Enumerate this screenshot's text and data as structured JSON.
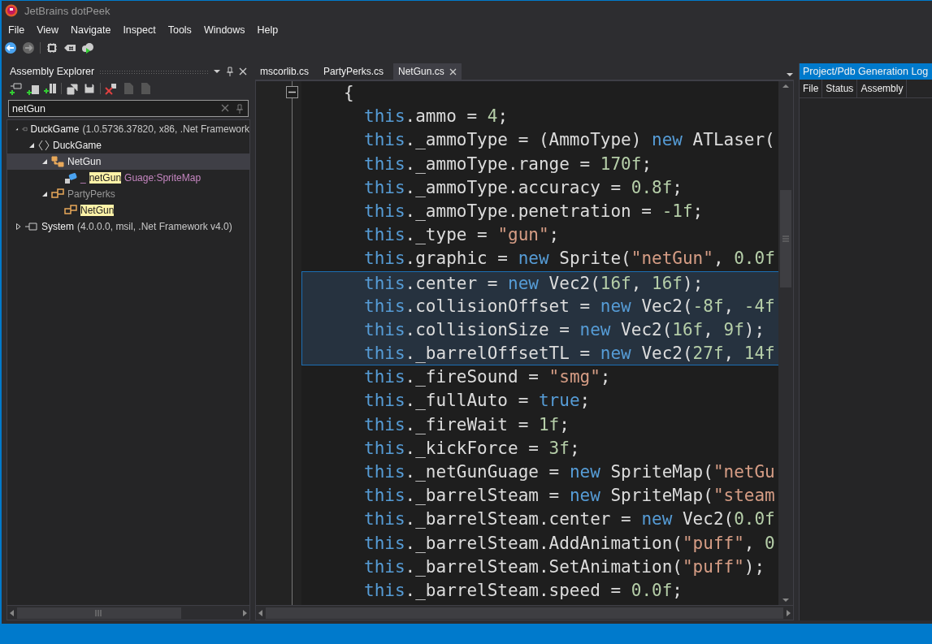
{
  "window": {
    "title": "JetBrains dotPeek"
  },
  "menu": [
    "File",
    "View",
    "Navigate",
    "Inspect",
    "Tools",
    "Windows",
    "Help"
  ],
  "assembly_explorer": {
    "title": "Assembly Explorer",
    "search": {
      "value": "netGun"
    },
    "tree": [
      {
        "kind": "assembly",
        "expanded": true,
        "selected": false,
        "parts": [
          {
            "text": "DuckGame",
            "kind": "name",
            "match": false
          },
          {
            "text": " (1.0.5736.37820, x86, .Net Framework",
            "kind": "meta",
            "match": false
          }
        ],
        "children": [
          {
            "kind": "namespace",
            "expanded": true,
            "selected": false,
            "parts": [
              {
                "text": "DuckGame",
                "kind": "name",
                "match": false
              }
            ],
            "children": [
              {
                "kind": "class",
                "expanded": true,
                "selected": true,
                "parts": [
                  {
                    "text": "NetGun",
                    "kind": "name",
                    "match": false
                  }
                ],
                "children": [
                  {
                    "kind": "field",
                    "selected": false,
                    "parts": [
                      {
                        "text": "_",
                        "kind": "member",
                        "match": false
                      },
                      {
                        "text": "netGun",
                        "kind": "name",
                        "match": true
                      },
                      {
                        "text": "Guage:SpriteMap",
                        "kind": "member",
                        "match": false
                      }
                    ]
                  }
                ]
              },
              {
                "kind": "type",
                "expanded": true,
                "selected": false,
                "parts": [
                  {
                    "text": "PartyPerks",
                    "kind": "dim",
                    "match": false
                  }
                ],
                "children": [
                  {
                    "kind": "type",
                    "selected": false,
                    "parts": [
                      {
                        "text": "NetGun",
                        "kind": "name",
                        "match": true
                      }
                    ]
                  }
                ]
              }
            ]
          }
        ]
      },
      {
        "kind": "assembly",
        "expanded": false,
        "selected": false,
        "parts": [
          {
            "text": "System",
            "kind": "name",
            "match": false
          },
          {
            "text": " (4.0.0.0, msil, .Net Framework v4.0)",
            "kind": "meta",
            "match": false
          }
        ]
      }
    ]
  },
  "tabs": [
    {
      "label": "mscorlib.cs",
      "selected": false
    },
    {
      "label": "PartyPerks.cs",
      "selected": false
    },
    {
      "label": "NetGun.cs",
      "selected": true
    }
  ],
  "code": [
    {
      "selected": false,
      "tokens": [
        {
          "text": "{",
          "kind": "plain"
        }
      ],
      "children": [
        {
          "selected": false,
          "tokens": [
            {
              "text": "this",
              "kind": "kw"
            },
            {
              "text": ".ammo = ",
              "kind": "plain"
            },
            {
              "text": "4",
              "kind": "num"
            },
            {
              "text": ";",
              "kind": "plain"
            }
          ]
        },
        {
          "selected": false,
          "tokens": [
            {
              "text": "this",
              "kind": "kw"
            },
            {
              "text": "._ammoType = (AmmoType) ",
              "kind": "plain"
            },
            {
              "text": "new",
              "kind": "kw"
            },
            {
              "text": " ATLaser(",
              "kind": "plain"
            }
          ]
        },
        {
          "selected": false,
          "tokens": [
            {
              "text": "this",
              "kind": "kw"
            },
            {
              "text": "._ammoType.range = ",
              "kind": "plain"
            },
            {
              "text": "170f",
              "kind": "num"
            },
            {
              "text": ";",
              "kind": "plain"
            }
          ]
        },
        {
          "selected": false,
          "tokens": [
            {
              "text": "this",
              "kind": "kw"
            },
            {
              "text": "._ammoType.accuracy = ",
              "kind": "plain"
            },
            {
              "text": "0.8f",
              "kind": "num"
            },
            {
              "text": ";",
              "kind": "plain"
            }
          ]
        },
        {
          "selected": false,
          "tokens": [
            {
              "text": "this",
              "kind": "kw"
            },
            {
              "text": "._ammoType.penetration = ",
              "kind": "plain"
            },
            {
              "text": "-1f",
              "kind": "num"
            },
            {
              "text": ";",
              "kind": "plain"
            }
          ]
        },
        {
          "selected": false,
          "tokens": [
            {
              "text": "this",
              "kind": "kw"
            },
            {
              "text": "._type = ",
              "kind": "plain"
            },
            {
              "text": "\"gun\"",
              "kind": "str"
            },
            {
              "text": ";",
              "kind": "plain"
            }
          ]
        },
        {
          "selected": false,
          "tokens": [
            {
              "text": "this",
              "kind": "kw"
            },
            {
              "text": ".graphic = ",
              "kind": "plain"
            },
            {
              "text": "new",
              "kind": "kw"
            },
            {
              "text": " Sprite(",
              "kind": "plain"
            },
            {
              "text": "\"netGun\"",
              "kind": "str"
            },
            {
              "text": ", ",
              "kind": "plain"
            },
            {
              "text": "0.0f",
              "kind": "num"
            }
          ]
        },
        {
          "selected": true,
          "tokens": [
            {
              "text": "this",
              "kind": "kw"
            },
            {
              "text": ".center = ",
              "kind": "plain"
            },
            {
              "text": "new",
              "kind": "kw"
            },
            {
              "text": " Vec2(",
              "kind": "plain"
            },
            {
              "text": "16f",
              "kind": "num"
            },
            {
              "text": ", ",
              "kind": "plain"
            },
            {
              "text": "16f",
              "kind": "num"
            },
            {
              "text": ");",
              "kind": "plain"
            }
          ]
        },
        {
          "selected": true,
          "tokens": [
            {
              "text": "this",
              "kind": "kw"
            },
            {
              "text": ".collisionOffset = ",
              "kind": "plain"
            },
            {
              "text": "new",
              "kind": "kw"
            },
            {
              "text": " Vec2(",
              "kind": "plain"
            },
            {
              "text": "-8f",
              "kind": "num"
            },
            {
              "text": ", ",
              "kind": "plain"
            },
            {
              "text": "-4f",
              "kind": "num"
            }
          ]
        },
        {
          "selected": true,
          "tokens": [
            {
              "text": "this",
              "kind": "kw"
            },
            {
              "text": ".collisionSize = ",
              "kind": "plain"
            },
            {
              "text": "new",
              "kind": "kw"
            },
            {
              "text": " Vec2(",
              "kind": "plain"
            },
            {
              "text": "16f",
              "kind": "num"
            },
            {
              "text": ", ",
              "kind": "plain"
            },
            {
              "text": "9f",
              "kind": "num"
            },
            {
              "text": ");",
              "kind": "plain"
            }
          ]
        },
        {
          "selected": true,
          "tokens": [
            {
              "text": "this",
              "kind": "kw"
            },
            {
              "text": "._barrelOffsetTL = ",
              "kind": "plain"
            },
            {
              "text": "new",
              "kind": "kw"
            },
            {
              "text": " Vec2(",
              "kind": "plain"
            },
            {
              "text": "27f",
              "kind": "num"
            },
            {
              "text": ", ",
              "kind": "plain"
            },
            {
              "text": "14f",
              "kind": "num"
            }
          ]
        },
        {
          "selected": false,
          "tokens": [
            {
              "text": "this",
              "kind": "kw"
            },
            {
              "text": "._fireSound = ",
              "kind": "plain"
            },
            {
              "text": "\"smg\"",
              "kind": "str"
            },
            {
              "text": ";",
              "kind": "plain"
            }
          ]
        },
        {
          "selected": false,
          "tokens": [
            {
              "text": "this",
              "kind": "kw"
            },
            {
              "text": "._fullAuto = ",
              "kind": "plain"
            },
            {
              "text": "true",
              "kind": "kw"
            },
            {
              "text": ";",
              "kind": "plain"
            }
          ]
        },
        {
          "selected": false,
          "tokens": [
            {
              "text": "this",
              "kind": "kw"
            },
            {
              "text": "._fireWait = ",
              "kind": "plain"
            },
            {
              "text": "1f",
              "kind": "num"
            },
            {
              "text": ";",
              "kind": "plain"
            }
          ]
        },
        {
          "selected": false,
          "tokens": [
            {
              "text": "this",
              "kind": "kw"
            },
            {
              "text": "._kickForce = ",
              "kind": "plain"
            },
            {
              "text": "3f",
              "kind": "num"
            },
            {
              "text": ";",
              "kind": "plain"
            }
          ]
        },
        {
          "selected": false,
          "tokens": [
            {
              "text": "this",
              "kind": "kw"
            },
            {
              "text": "._netGunGuage = ",
              "kind": "plain"
            },
            {
              "text": "new",
              "kind": "kw"
            },
            {
              "text": " SpriteMap(",
              "kind": "plain"
            },
            {
              "text": "\"netGu",
              "kind": "str"
            }
          ]
        },
        {
          "selected": false,
          "tokens": [
            {
              "text": "this",
              "kind": "kw"
            },
            {
              "text": "._barrelSteam = ",
              "kind": "plain"
            },
            {
              "text": "new",
              "kind": "kw"
            },
            {
              "text": " SpriteMap(",
              "kind": "plain"
            },
            {
              "text": "\"steam",
              "kind": "str"
            }
          ]
        },
        {
          "selected": false,
          "tokens": [
            {
              "text": "this",
              "kind": "kw"
            },
            {
              "text": "._barrelSteam.center = ",
              "kind": "plain"
            },
            {
              "text": "new",
              "kind": "kw"
            },
            {
              "text": " Vec2(",
              "kind": "plain"
            },
            {
              "text": "0.0f",
              "kind": "num"
            }
          ]
        },
        {
          "selected": false,
          "tokens": [
            {
              "text": "this",
              "kind": "kw"
            },
            {
              "text": "._barrelSteam.AddAnimation(",
              "kind": "plain"
            },
            {
              "text": "\"puff\"",
              "kind": "str"
            },
            {
              "text": ", ",
              "kind": "plain"
            },
            {
              "text": "0",
              "kind": "num"
            }
          ]
        },
        {
          "selected": false,
          "tokens": [
            {
              "text": "this",
              "kind": "kw"
            },
            {
              "text": "._barrelSteam.SetAnimation(",
              "kind": "plain"
            },
            {
              "text": "\"puff\"",
              "kind": "str"
            },
            {
              "text": ");",
              "kind": "plain"
            }
          ]
        },
        {
          "selected": false,
          "tokens": [
            {
              "text": "this",
              "kind": "kw"
            },
            {
              "text": "._barrelSteam.speed = ",
              "kind": "plain"
            },
            {
              "text": "0.0f",
              "kind": "num"
            },
            {
              "text": ";",
              "kind": "plain"
            }
          ]
        }
      ]
    }
  ],
  "log_panel": {
    "title": "Project/Pdb Generation Log",
    "columns": [
      "File",
      "Status",
      "Assembly"
    ]
  }
}
